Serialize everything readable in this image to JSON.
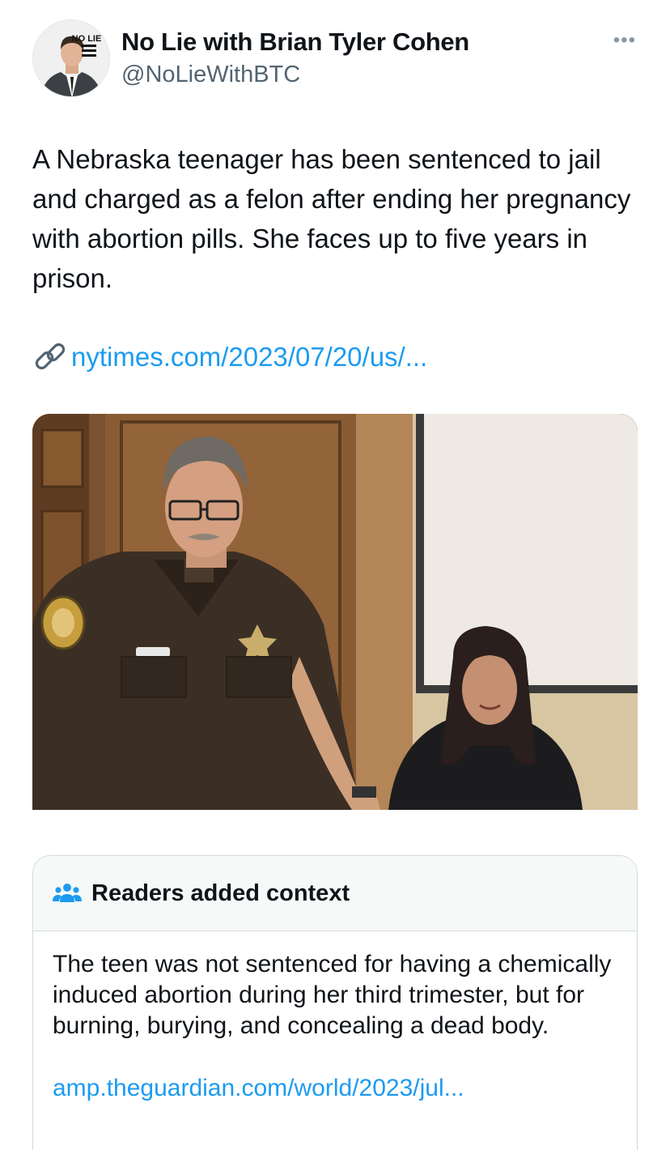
{
  "author": {
    "name": "No Lie with Brian Tyler Cohen",
    "handle": "@NoLieWithBTC",
    "avatar_badge": "NO LIE",
    "avatar_badge_sub": "with BRIAN TYLER COHEN"
  },
  "tweet": {
    "text": "A Nebraska teenager has been sentenced to jail and charged as a felon after ending her pregnancy with abortion pills. She faces up to five years in prison.",
    "link": "nytimes.com/2023/07/20/us/...",
    "link_icon": "link-chain-icon",
    "more_icon": "more-options-icon"
  },
  "media": {
    "icon": "photo-image"
  },
  "community_note": {
    "title": "Readers added context",
    "icon": "people-icon",
    "body": "The teen was not sentenced for having a chemically induced abortion during her third trimester, but for burning, burying, and concealing a dead body.",
    "link": "amp.theguardian.com/world/2023/jul..."
  },
  "colors": {
    "link": "#1d9bf0",
    "secondary_text": "#536471",
    "border": "#cfd9de",
    "note_header_bg": "#f7f9f9"
  }
}
